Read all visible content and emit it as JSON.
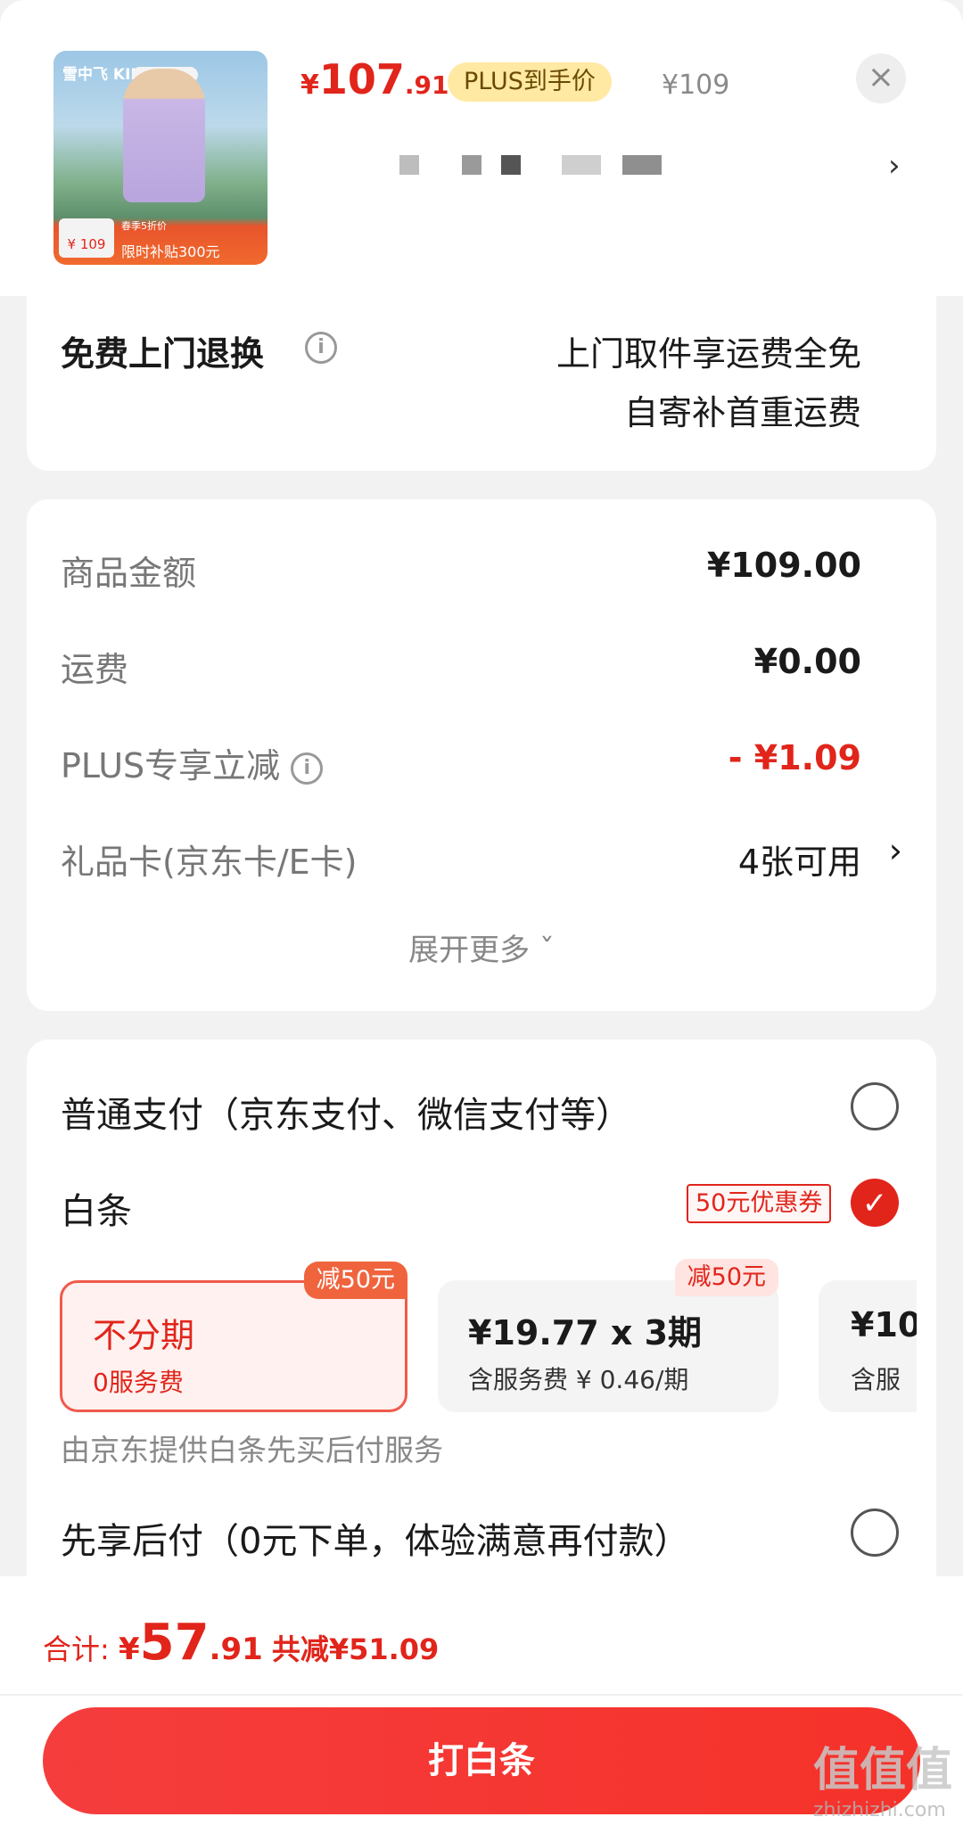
{
  "product": {
    "brand_on_image": "雪中飞 KIDS",
    "image_tag_price": "¥ 109",
    "image_tag_promo": "限时补贴300元",
    "image_tag_small": "春季5折价",
    "price_currency": "¥",
    "price_int": "107",
    "price_dec": ".91",
    "plus_badge": "PLUS到手价",
    "original_price": "¥109",
    "close": "×",
    "spec_arrow": "›"
  },
  "returns": {
    "title": "免费上门退换",
    "info_icon": "i",
    "line1": "上门取件享运费全免",
    "line2": "自寄补首重运费"
  },
  "summary": {
    "rows": [
      {
        "label": "商品金额",
        "value": "¥109.00"
      },
      {
        "label": "运费",
        "value": "¥0.00"
      },
      {
        "label": "PLUS专享立减",
        "value": "- ¥1.09"
      },
      {
        "label": "礼品卡(京东卡/E卡)",
        "value": "4张可用",
        "arrow": "›"
      }
    ],
    "expand": "展开更多 ˇ"
  },
  "payment": {
    "normal_label": "普通支付（京东支付、微信支付等）",
    "baitiao_label": "白条",
    "baitiao_coupon": "50元优惠券",
    "check_mark": "✓",
    "plans": [
      {
        "tag": "减50元",
        "main": "不分期",
        "sub": "0服务费"
      },
      {
        "tag": "减50元",
        "main": "¥19.77 x 3期",
        "sub": "含服务费 ¥ 0.46/期"
      },
      {
        "main": "¥10",
        "sub": "含服"
      }
    ],
    "baitiao_note": "由京东提供白条先买后付服务",
    "paylater_label": "先享后付（0元下单，体验满意再付款）"
  },
  "footer": {
    "total_label": "合计: ",
    "total_currency": "¥",
    "total_int": "57",
    "total_dec": ".91",
    "total_saved": "共减¥51.09",
    "button": "打白条"
  },
  "watermark": {
    "big": "值值值",
    "url": "zhizhizhi.com"
  },
  "colors": {
    "accent": "#e1251b",
    "plus_badge_bg": "#ffe9a3"
  }
}
